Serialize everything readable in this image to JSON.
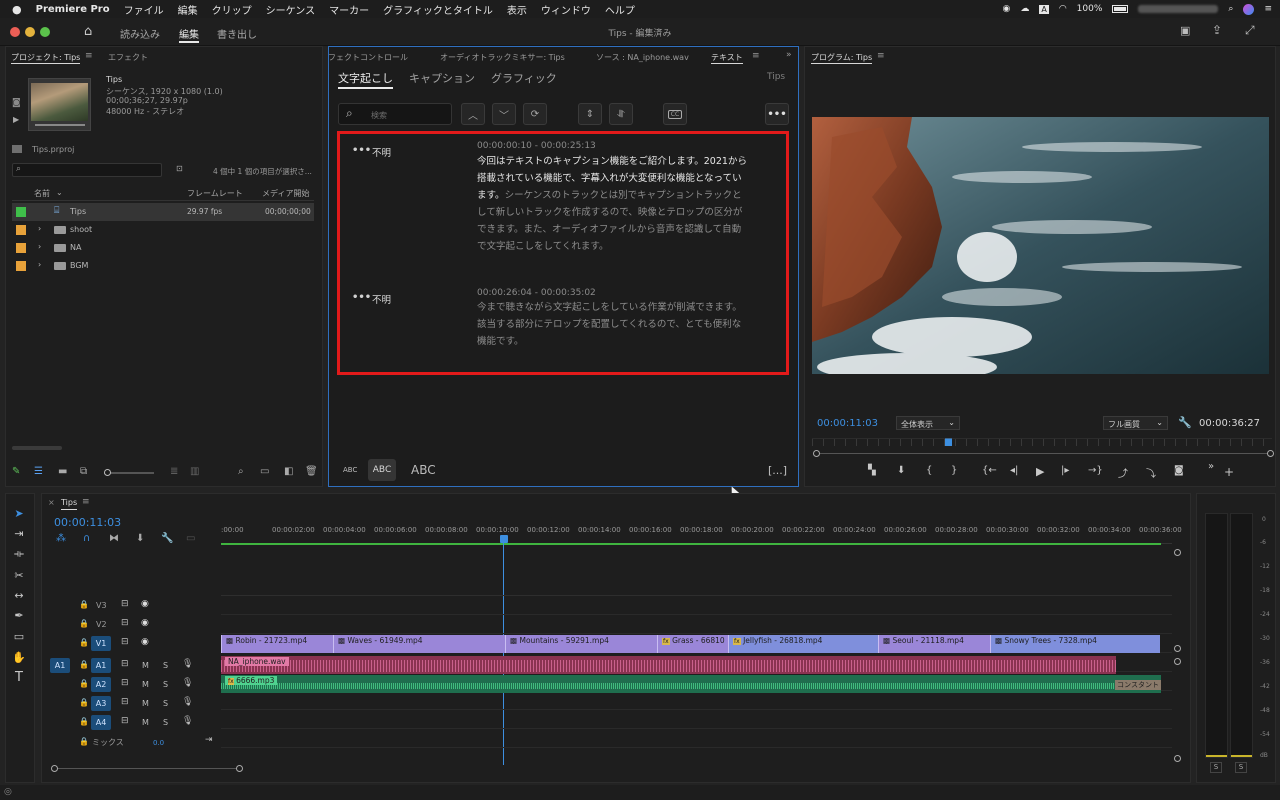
{
  "menubar": {
    "apple": "",
    "app": "Premiere Pro",
    "items": [
      "ファイル",
      "編集",
      "クリップ",
      "シーケンス",
      "マーカー",
      "グラフィックとタイトル",
      "表示",
      "ウィンドウ",
      "ヘルプ"
    ],
    "battery": "100%"
  },
  "titlebar": {
    "workspaces": [
      "読み込み",
      "編集",
      "書き出し"
    ],
    "title": "Tips - 編集済み"
  },
  "project": {
    "tabs": [
      "プロジェクト: Tips",
      "エフェクト"
    ],
    "seq_name": "Tips",
    "seq_info1": "シーケンス, 1920 x 1080 (1.0)",
    "seq_info2": "00;00;36;27, 29.97p",
    "seq_info3": "48000 Hz - ステレオ",
    "file": "Tips.prproj",
    "selection": "4 個中 1 個の項目が選択さ...",
    "col_name": "名前",
    "col_fps": "フレームレート",
    "col_media": "メディア開始",
    "rows": [
      {
        "name": "Tips",
        "fps": "29.97 fps",
        "start": "00;00;00;00",
        "color": "#3fbf4a"
      },
      {
        "name": "shoot",
        "fps": "",
        "start": "",
        "color": "#e8a23a"
      },
      {
        "name": "NA",
        "fps": "",
        "start": "",
        "color": "#e8a23a"
      },
      {
        "name": "BGM",
        "fps": "",
        "start": "",
        "color": "#e8a23a"
      }
    ]
  },
  "textpanel": {
    "tabs": [
      "フェクトコントロール",
      "オーディオトラックミキサー: Tips",
      "ソース : NA_iphone.wav",
      "テキスト"
    ],
    "subtabs": [
      "文字起こし",
      "キャプション",
      "グラフィック"
    ],
    "seq": "Tips",
    "search_placeholder": "検索",
    "segments": [
      {
        "speaker": "不明",
        "time": "00:00:00:10 - 00:00:25:13",
        "lines_hl": [
          "今回はテキストのキャプション機能をご紹介します。2021から",
          "搭載されている機能で、字幕入れが大変便利な機能となってい",
          "ます。"
        ],
        "lines_hl_tail": "シーケンスのトラックとは別でキャプショントラックと",
        "lines": [
          "して新しいトラックを作成するので、映像とテロップの区分が",
          "できます。また、オーディオファイルから音声を認識して自動",
          "で文字起こしをしてくれます。"
        ]
      },
      {
        "speaker": "不明",
        "time": "00:00:26:04 - 00:00:35:02",
        "lines": [
          "今まで聴きながら文字起こしをしている作業が削減できます。",
          "該当する部分にテロップを配置してくれるので、とても便利な",
          "機能です。"
        ]
      }
    ],
    "abc": [
      "ABC",
      "ABC",
      "ABC"
    ],
    "bracket": "[...]"
  },
  "program": {
    "tab": "プログラム: Tips",
    "timecode": "00:00:11:03",
    "zoom": "全体表示",
    "quality": "フル画質",
    "duration": "00:00:36:27"
  },
  "timeline": {
    "tab": "Tips",
    "timecode": "00:00:11:03",
    "ruler": [
      ":00:00",
      "00:00:02:00",
      "00:00:04:00",
      "00:00:06:00",
      "00:00:08:00",
      "00:00:10:00",
      "00:00:12:00",
      "00:00:14:00",
      "00:00:16:00",
      "00:00:18:00",
      "00:00:20:00",
      "00:00:22:00",
      "00:00:24:00",
      "00:00:26:00",
      "00:00:28:00",
      "00:00:30:00",
      "00:00:32:00",
      "00:00:34:00",
      "00:00:36:00"
    ],
    "tracks": [
      "V3",
      "V2",
      "V1",
      "A1",
      "A2",
      "A3",
      "A4"
    ],
    "src_a1": "A1",
    "mix_label": "ミックス",
    "mix_value": "0.0",
    "m": "M",
    "s": "S",
    "video_clips": [
      {
        "name": "Robin - 21723.mp4",
        "color": "#9a86d8"
      },
      {
        "name": "Waves - 61949.mp4",
        "color": "#9a86d8"
      },
      {
        "name": "Mountains - 59291.mp4",
        "color": "#9a86d8"
      },
      {
        "name": "Grass - 66810",
        "color": "#9a86d8"
      },
      {
        "name": "Jellyfish - 26818.mp4",
        "color": "#7f8fdc"
      },
      {
        "name": "Seoul - 21118.mp4",
        "color": "#9a86d8"
      },
      {
        "name": "Snowy Trees - 7328.mp4",
        "color": "#7f8fdc"
      }
    ],
    "audio1": "NA_iphone.wav",
    "audio2": "6666.mp3",
    "constant": "コンスタント"
  },
  "meter": {
    "labels": [
      "0",
      "-6",
      "-12",
      "-18",
      "-24",
      "-30",
      "-36",
      "-42",
      "-48",
      "-54",
      "dB"
    ],
    "solo": [
      "S",
      "S"
    ]
  }
}
